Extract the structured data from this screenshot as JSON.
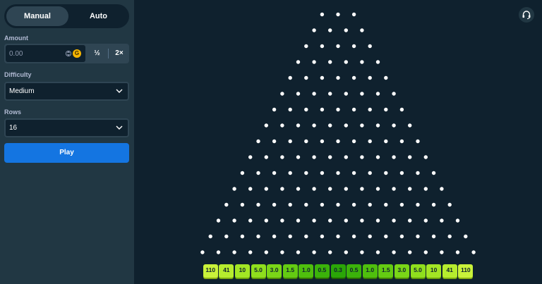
{
  "sidebar": {
    "mode_tabs": {
      "manual": "Manual",
      "auto": "Auto",
      "active": "Manual"
    },
    "amount": {
      "label": "Amount",
      "value": "",
      "placeholder": "0.00",
      "currency_icon": "coin-icon",
      "currency_letter": "G",
      "half_label": "½",
      "double_label": "2×"
    },
    "difficulty": {
      "label": "Difficulty",
      "value": "Medium"
    },
    "rows": {
      "label": "Rows",
      "value": "16"
    },
    "play_label": "Play"
  },
  "board": {
    "rows": 16,
    "multipliers": [
      "110",
      "41",
      "10",
      "5.0",
      "3.0",
      "1.5",
      "1.0",
      "0.5",
      "0.3",
      "0.5",
      "1.0",
      "1.5",
      "3.0",
      "5.0",
      "10",
      "41",
      "110"
    ],
    "multiplier_colors": [
      "#c9f23a",
      "#b6ec2e",
      "#a3e624",
      "#8fdf1d",
      "#7ad617",
      "#64cb12",
      "#4fbf0d",
      "#3bb30a",
      "#2aa607",
      "#3bb30a",
      "#4fbf0d",
      "#64cb12",
      "#7ad617",
      "#8fdf1d",
      "#a3e624",
      "#b6ec2e",
      "#c9f23a"
    ],
    "multiplier_shadow_colors": [
      "#8aad14",
      "#7ba811",
      "#6c9f0c",
      "#5d9509",
      "#4f8a07",
      "#418006",
      "#357504",
      "#2a6b03",
      "#1f6102",
      "#2a6b03",
      "#357504",
      "#418006",
      "#4f8a07",
      "#5d9509",
      "#6c9f0c",
      "#7ba811",
      "#8aad14"
    ],
    "headset_icon": "headset-icon"
  },
  "colors": {
    "peg": "#ffffff",
    "play_button": "#1475e1",
    "sidebar_bg": "#213743",
    "board_bg": "#0f212e"
  }
}
